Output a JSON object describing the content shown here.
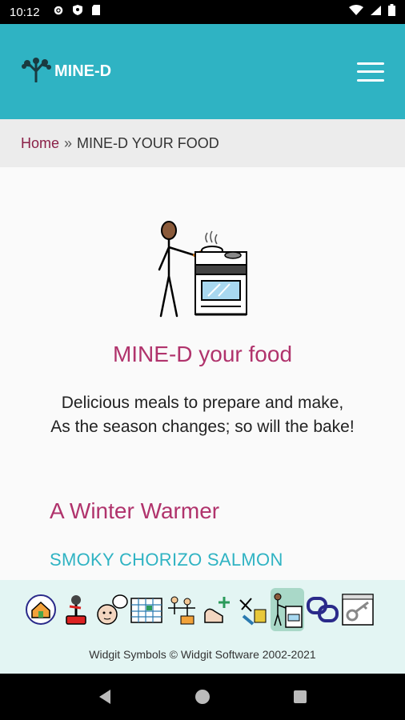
{
  "status_bar": {
    "time": "10:12",
    "left_icons": [
      "gear-icon",
      "shield-icon",
      "sd-card-icon"
    ],
    "right_icons": [
      "wifi-icon",
      "signal-icon",
      "battery-icon"
    ]
  },
  "app_bar": {
    "brand": "MINE-D",
    "logo_icon": "tree-logo-icon",
    "menu_icon": "hamburger-menu-icon",
    "color": "#2fb3c3"
  },
  "breadcrumb": {
    "home": "Home",
    "separator": "»",
    "current": "MINE-D YOUR FOOD"
  },
  "main": {
    "hero_icon": "person-cooking-icon",
    "title": "MINE-D your food",
    "tagline_line1": "Delicious meals to prepare and make,",
    "tagline_line2": "As the season changes; so will the bake!",
    "section_heading": "A Winter Warmer",
    "recipe_link": "SMOKY CHORIZO SALMON",
    "accent_pink": "#b0336c",
    "accent_teal": "#2fb3c3"
  },
  "symbol_bar": {
    "items": [
      {
        "icon": "home-icon",
        "active": false
      },
      {
        "icon": "joystick-icon",
        "active": false
      },
      {
        "icon": "thinking-face-icon",
        "active": false
      },
      {
        "icon": "calendar-grid-icon",
        "active": false
      },
      {
        "icon": "group-activity-icon",
        "active": false
      },
      {
        "icon": "hand-add-icon",
        "active": false
      },
      {
        "icon": "tools-craft-icon",
        "active": false
      },
      {
        "icon": "cooking-icon",
        "active": true
      },
      {
        "icon": "chain-link-icon",
        "active": false
      },
      {
        "icon": "key-window-icon",
        "active": false
      }
    ],
    "copyright": "Widgit Symbols © Widgit Software 2002-2021"
  },
  "nav_bar": {
    "buttons": [
      "back-icon",
      "home-circle-icon",
      "recents-icon"
    ]
  }
}
